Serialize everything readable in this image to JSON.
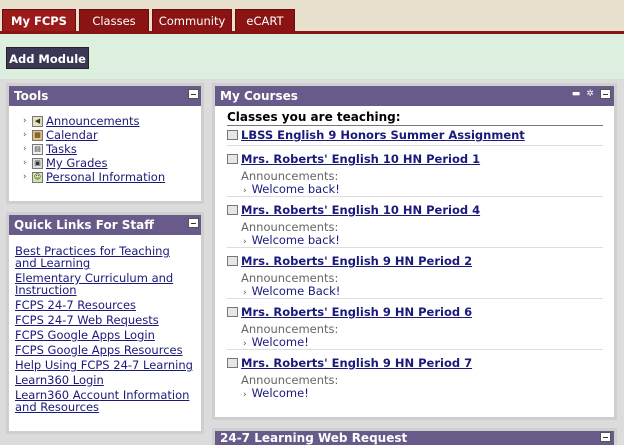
{
  "tabs": [
    {
      "label": "My FCPS",
      "active": true
    },
    {
      "label": "Classes",
      "active": false
    },
    {
      "label": "Community",
      "active": false
    },
    {
      "label": "eCART",
      "active": false
    }
  ],
  "toolbar": {
    "add_module_label": "Add Module"
  },
  "tools": {
    "title": "Tools",
    "items": [
      {
        "label": "Announcements",
        "icon": "megaphone-icon"
      },
      {
        "label": "Calendar",
        "icon": "calendar-icon"
      },
      {
        "label": "Tasks",
        "icon": "tasks-icon"
      },
      {
        "label": "My Grades",
        "icon": "grades-icon"
      },
      {
        "label": "Personal Information",
        "icon": "person-icon"
      }
    ]
  },
  "quick_links": {
    "title": "Quick Links For Staff",
    "items": [
      "Best Practices for Teaching and Learning",
      "Elementary Curriculum and Instruction",
      "FCPS 24-7 Resources",
      "FCPS 24-7 Web Requests",
      "FCPS Google Apps Login",
      "FCPS Google Apps Resources",
      "Help Using FCPS 24-7 Learning",
      "Learn360 Login",
      "Learn360 Account Information and Resources"
    ]
  },
  "my_courses": {
    "title": "My Courses",
    "teaching_label": "Classes you are teaching:",
    "announcements_label": "Announcements:",
    "courses": [
      {
        "name": "LBSS English 9 Honors Summer Assignment",
        "announcement": ""
      },
      {
        "name": "Mrs. Roberts' English 10 HN Period 1",
        "announcement": "Welcome back!"
      },
      {
        "name": "Mrs. Roberts' English 10 HN Period 4",
        "announcement": "Welcome back!"
      },
      {
        "name": "Mrs. Roberts' English 9 HN Period 2",
        "announcement": "Welcome Back!"
      },
      {
        "name": "Mrs. Roberts' English 9 HN Period 6",
        "announcement": "Welcome!"
      },
      {
        "name": "Mrs. Roberts' English 9 HN Period 7",
        "announcement": "Welcome!"
      }
    ]
  },
  "bottom_module": {
    "title": "24-7 Learning Web Request"
  },
  "colors": {
    "tab_red": "#8a1414",
    "header_purple": "#685a89",
    "link_blue": "#1a1a7a",
    "module_bar_green": "#ddf0df"
  }
}
